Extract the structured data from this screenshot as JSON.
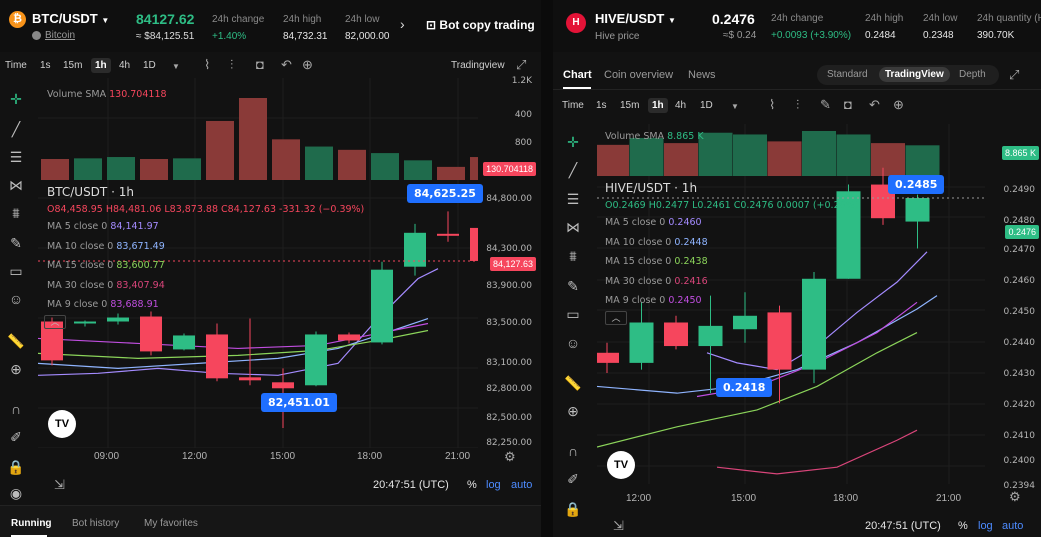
{
  "left": {
    "pair": "BTC/USDT",
    "coin_link": "Bitcoin",
    "price": "84127.62",
    "price_usd": "≈ $84,125.51",
    "stats": [
      {
        "label": "24h change",
        "value": "+1.40%"
      },
      {
        "label": "24h high",
        "value": "84,732.31"
      },
      {
        "label": "24h low",
        "value": "82,000.00"
      }
    ],
    "bot_copy": "Bot copy trading",
    "toolbar": {
      "time": "Time",
      "intervals": [
        "1s",
        "15m",
        "1h",
        "4h",
        "1D"
      ],
      "active": "1h",
      "source": "Tradingview"
    },
    "volume_label": "Volume SMA",
    "volume_val": "130.704118",
    "symbol_line": "BTC/USDT · 1h",
    "ohlc": "O84,458.95 H84,481.06 L83,873.88 C84,127.63 -331.32 (−0.39%)",
    "mas": [
      {
        "label": "MA 5 close 0",
        "value": "84,141.97",
        "color": "#a48bff"
      },
      {
        "label": "MA 10 close 0",
        "value": "83,671.49",
        "color": "#8fb4ff"
      },
      {
        "label": "MA 15 close 0",
        "value": "83,600.77",
        "color": "#8bd45a"
      },
      {
        "label": "MA 30 close 0",
        "value": "83,407.94",
        "color": "#d9457a"
      },
      {
        "label": "MA 9 close 0",
        "value": "83,688.91",
        "color": "#c04ee0"
      }
    ],
    "axis": [
      "1.2K",
      "400",
      "800",
      "84,800.00",
      "84,300.00",
      "83,900.00",
      "83,500.00",
      "83,100.00",
      "82,800.00",
      "82,500.00",
      "82,250.00"
    ],
    "axis_tags": {
      "volume": "130.704118",
      "price": "84,127.63"
    },
    "bubbles": {
      "high": "84,625.25",
      "low": "82,451.01"
    },
    "xlabels": [
      "09:00",
      "12:00",
      "15:00",
      "18:00",
      "21:00"
    ],
    "footer": {
      "time": "20:47:51 (UTC)",
      "pct": "%",
      "log": "log",
      "auto": "auto"
    },
    "bottom_tabs": [
      "Running",
      "Bot history",
      "My favorites"
    ],
    "chart_data": {
      "type": "candlestick",
      "candles": [
        {
          "o": 83520,
          "c": 83130,
          "h": 83560,
          "l": 83080
        },
        {
          "o": 83500,
          "c": 83520,
          "h": 83530,
          "l": 83470
        },
        {
          "o": 83520,
          "c": 83560,
          "h": 83600,
          "l": 83490
        },
        {
          "o": 83570,
          "c": 83220,
          "h": 83620,
          "l": 83180
        },
        {
          "o": 83240,
          "c": 83380,
          "h": 83400,
          "l": 83230
        },
        {
          "o": 83390,
          "c": 82950,
          "h": 83500,
          "l": 82920
        },
        {
          "o": 82960,
          "c": 82930,
          "h": 83550,
          "l": 82880
        },
        {
          "o": 82910,
          "c": 82850,
          "h": 83050,
          "l": 82451.01
        },
        {
          "o": 82880,
          "c": 83390,
          "h": 83420,
          "l": 82870
        },
        {
          "o": 83390,
          "c": 83330,
          "h": 83410,
          "l": 83300
        },
        {
          "o": 83310,
          "c": 84040,
          "h": 84120,
          "l": 83290
        },
        {
          "o": 84070,
          "c": 84410,
          "h": 84500,
          "l": 83980
        },
        {
          "o": 84400,
          "c": 84380,
          "h": 84625.25,
          "l": 84320
        },
        {
          "o": 84458.95,
          "c": 84127.63,
          "h": 84481.06,
          "l": 83873.88
        }
      ],
      "volume": [
        320,
        330,
        350,
        320,
        330,
        900,
        1250,
        620,
        510,
        460,
        410,
        300,
        200,
        350
      ]
    }
  },
  "right": {
    "pair": "HIVE/USDT",
    "subtitle": "Hive price",
    "price": "0.2476",
    "price_usd": "≈$ 0.24",
    "stats": [
      {
        "label": "24h change",
        "value": "+0.0093 (+3.90%)"
      },
      {
        "label": "24h high",
        "value": "0.2484"
      },
      {
        "label": "24h low",
        "value": "0.2348"
      },
      {
        "label": "24h quantity (H",
        "value": "390.70K"
      }
    ],
    "tabs": [
      "Chart",
      "Coin overview",
      "News"
    ],
    "modes": [
      "Standard",
      "TradingView",
      "Depth"
    ],
    "toolbar": {
      "time": "Time",
      "intervals": [
        "1s",
        "15m",
        "1h",
        "4h",
        "1D"
      ],
      "active": "1h"
    },
    "volume_label": "Volume SMA",
    "volume_val": "8.865 K",
    "symbol_line": "HIVE/USDT · 1h",
    "ohlc": "O0.2469 H0.2477 L0.2461 C0.2476 0.0007 (+0.28%)",
    "mas": [
      {
        "label": "MA 5 close 0",
        "value": "0.2460",
        "color": "#a48bff"
      },
      {
        "label": "MA 10 close 0",
        "value": "0.2448",
        "color": "#8fb4ff"
      },
      {
        "label": "MA 15 close 0",
        "value": "0.2438",
        "color": "#8bd45a"
      },
      {
        "label": "MA 30 close 0",
        "value": "0.2416",
        "color": "#d9457a"
      },
      {
        "label": "MA 9 close 0",
        "value": "0.2450",
        "color": "#c04ee0"
      }
    ],
    "axis": [
      "0.2490",
      "0.2480",
      "0.2470",
      "0.2460",
      "0.2450",
      "0.2440",
      "0.2430",
      "0.2420",
      "0.2410",
      "0.2400",
      "0.2394"
    ],
    "axis_tags": {
      "volume": "8.865 K",
      "price": "0.2476"
    },
    "bubbles": {
      "high": "0.2485",
      "low": "0.2418"
    },
    "xlabels": [
      "12:00",
      "15:00",
      "18:00",
      "21:00"
    ],
    "footer": {
      "time": "20:47:51 (UTC)",
      "pct": "%",
      "log": "log",
      "auto": "auto"
    },
    "chart_data": {
      "type": "candlestick",
      "candles": [
        {
          "o": 0.243,
          "c": 0.2427,
          "h": 0.2433,
          "l": 0.2424
        },
        {
          "o": 0.2427,
          "c": 0.2439,
          "h": 0.2445,
          "l": 0.2425
        },
        {
          "o": 0.2439,
          "c": 0.2432,
          "h": 0.2441,
          "l": 0.2431
        },
        {
          "o": 0.2432,
          "c": 0.2438,
          "h": 0.2447,
          "l": 0.2418
        },
        {
          "o": 0.2437,
          "c": 0.2441,
          "h": 0.2448,
          "l": 0.2433
        },
        {
          "o": 0.2442,
          "c": 0.2425,
          "h": 0.2444,
          "l": 0.2415
        },
        {
          "o": 0.2425,
          "c": 0.2452,
          "h": 0.2454,
          "l": 0.2421
        },
        {
          "o": 0.2452,
          "c": 0.2478,
          "h": 0.248,
          "l": 0.2452
        },
        {
          "o": 0.248,
          "c": 0.247,
          "h": 0.2485,
          "l": 0.2468
        },
        {
          "o": 0.2469,
          "c": 0.2476,
          "h": 0.2477,
          "l": 0.2461
        }
      ],
      "volume": [
        9000,
        11000,
        9500,
        12500,
        12000,
        10000,
        13000,
        12000,
        9500,
        8865
      ]
    }
  }
}
